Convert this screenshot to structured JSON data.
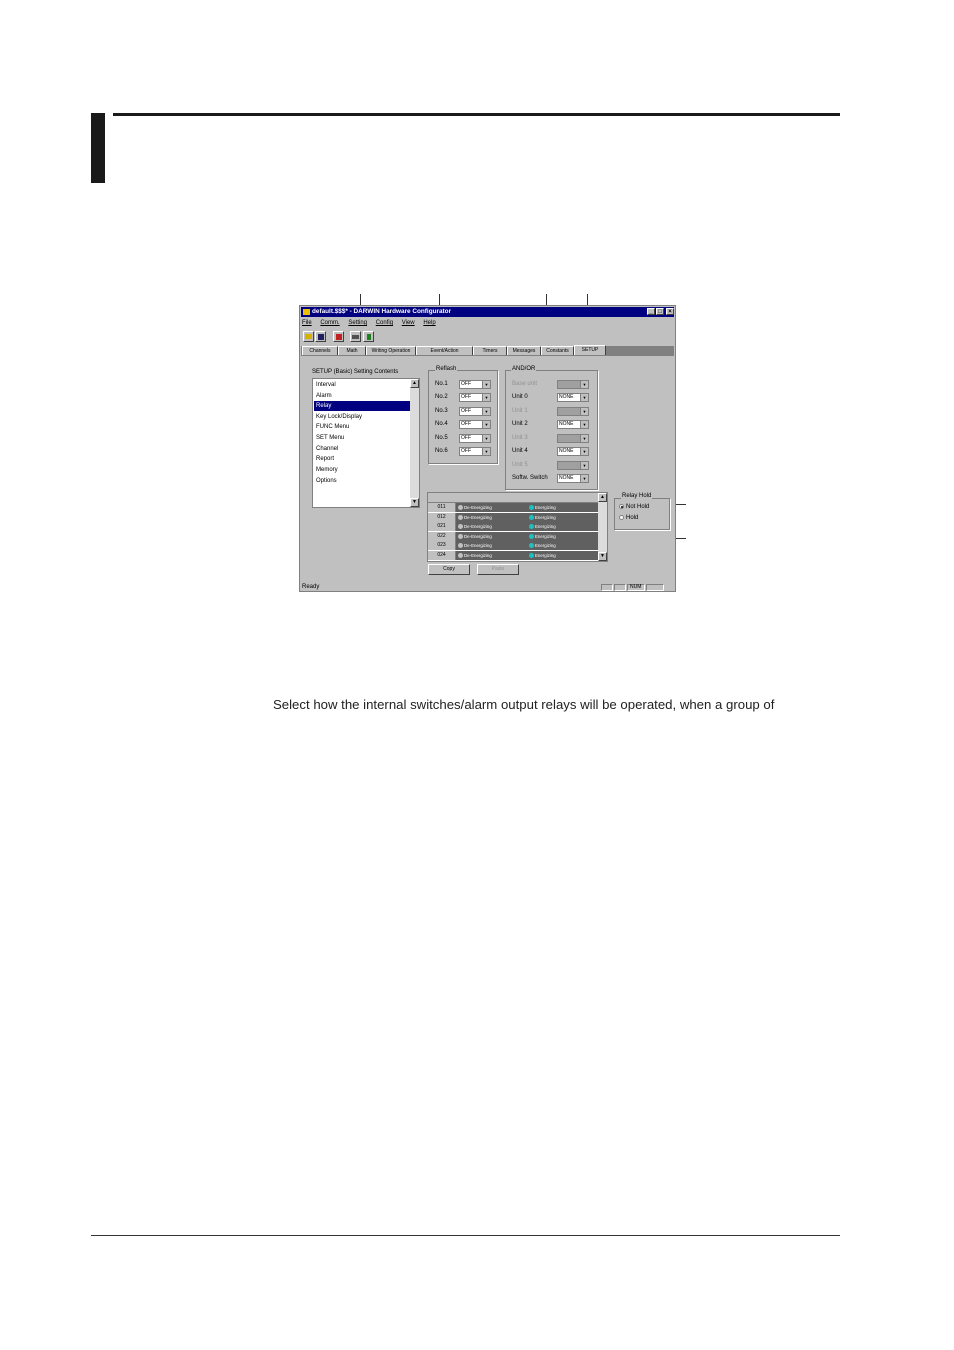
{
  "page": {
    "body_text": "Select how the internal switches/alarm output relays will be operated, when a group of"
  },
  "window": {
    "title": "default.$$$* - DARWIN Hardware Configurator",
    "title_buttons": [
      "_",
      "□",
      "×"
    ],
    "menu": [
      "File",
      "Comm.",
      "Setting",
      "Config",
      "View",
      "Help"
    ],
    "toolbar_icons": [
      "open-icon",
      "save-icon",
      "delete-icon",
      "print-icon",
      "help-icon"
    ],
    "tabs": [
      "Channels",
      "Math",
      "Writing Operation",
      "Event/Action",
      "Timers",
      "Messages",
      "Constants",
      "SETUP"
    ],
    "active_tab": "SETUP",
    "setup_label": "SETUP (Basic) Setting Contents",
    "setup_items": [
      "Interval",
      "Alarm",
      "Relay",
      "Key Lock/Display",
      "FUNC Menu",
      "SET Menu",
      "Channel",
      "Report",
      "Memory",
      "Options"
    ],
    "selected_item": "Relay",
    "reflash": {
      "title": "Reflash",
      "rows": [
        {
          "label": "No.1",
          "value": "OFF"
        },
        {
          "label": "No.2",
          "value": "OFF"
        },
        {
          "label": "No.3",
          "value": "OFF"
        },
        {
          "label": "No.4",
          "value": "OFF"
        },
        {
          "label": "No.5",
          "value": "OFF"
        },
        {
          "label": "No.6",
          "value": "OFF"
        }
      ]
    },
    "andor": {
      "title": "AND/OR",
      "rows": [
        {
          "label": "Base unit",
          "value": "",
          "disabled": true
        },
        {
          "label": "Unit 0",
          "value": "NONE",
          "disabled": false
        },
        {
          "label": "Unit 1",
          "value": "",
          "disabled": true
        },
        {
          "label": "Unit 2",
          "value": "NONE",
          "disabled": false
        },
        {
          "label": "Unit 3",
          "value": "",
          "disabled": true
        },
        {
          "label": "Unit 4",
          "value": "NONE",
          "disabled": false
        },
        {
          "label": "Unit 5",
          "value": "",
          "disabled": true
        },
        {
          "label": "Softw. Switch",
          "value": "NONE",
          "disabled": false
        }
      ]
    },
    "relay_hold": {
      "title": "Relay Hold",
      "options": [
        "Not Hold",
        "Hold"
      ],
      "selected": "Not Hold"
    },
    "relay_grid": {
      "rows": [
        {
          "id": "011",
          "off": "De-Energizing",
          "on": "Energizing"
        },
        {
          "id": "012",
          "off": "De-Energizing",
          "on": "Energizing"
        },
        {
          "id": "021",
          "off": "De-Energizing",
          "on": "Energizing"
        },
        {
          "id": "022",
          "off": "De-Energizing",
          "on": "Energizing"
        },
        {
          "id": "023",
          "off": "De-Energizing",
          "on": "Energizing"
        },
        {
          "id": "024",
          "off": "De-Energizing",
          "on": "Energizing"
        }
      ]
    },
    "buttons": {
      "copy": "Copy",
      "paste": "Paste"
    },
    "status": {
      "text": "Ready",
      "num": "NUM"
    },
    "colors": {
      "title_bg": "#000080",
      "face": "#c0c0c0",
      "energizing_dot": "#20c0c0",
      "grid_row": "#606060"
    }
  }
}
